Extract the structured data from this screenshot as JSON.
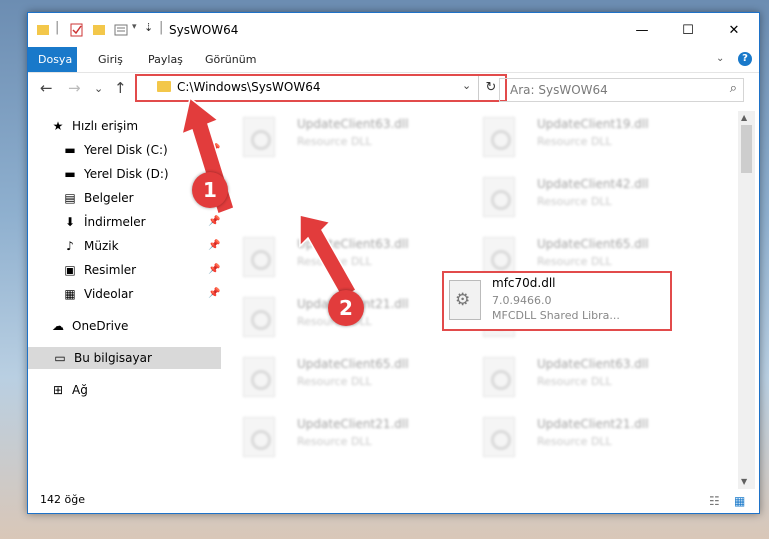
{
  "window": {
    "title": "SysWOW64",
    "minimize": "—",
    "maximize": "☐",
    "close": "✕",
    "help": "?"
  },
  "ribbon": {
    "tabs": [
      "Dosya",
      "Giriş",
      "Paylaş",
      "Görünüm"
    ]
  },
  "address": {
    "path": "C:\\Windows\\SysWOW64",
    "dropdown": "⌄",
    "refresh": "↻"
  },
  "search": {
    "placeholder": "Ara: SysWOW64",
    "icon": "search-icon"
  },
  "nav": {
    "back": "←",
    "forward": "→",
    "recent": "⌄",
    "up": "↑"
  },
  "sidebar": {
    "items": [
      {
        "label": "Hızlı erişim",
        "icon": "star-icon",
        "glyph": "★",
        "pinned": false
      },
      {
        "label": "Yerel Disk (C:)",
        "icon": "drive-icon",
        "glyph": "▬",
        "pinned": true
      },
      {
        "label": "Yerel Disk (D:)",
        "icon": "drive-icon",
        "glyph": "▬",
        "pinned": true
      },
      {
        "label": "Belgeler",
        "icon": "documents-icon",
        "glyph": "▤",
        "pinned": true
      },
      {
        "label": "İndirmeler",
        "icon": "download-icon",
        "glyph": "⬇",
        "pinned": true
      },
      {
        "label": "Müzik",
        "icon": "music-icon",
        "glyph": "♪",
        "pinned": true
      },
      {
        "label": "Resimler",
        "icon": "pictures-icon",
        "glyph": "▣",
        "pinned": true
      },
      {
        "label": "Videolar",
        "icon": "video-icon",
        "glyph": "▦",
        "pinned": true
      },
      {
        "label": "OneDrive",
        "icon": "cloud-icon",
        "glyph": "☁",
        "pinned": false
      },
      {
        "label": "Bu bilgisayar",
        "icon": "computer-icon",
        "glyph": "▭",
        "pinned": false
      },
      {
        "label": "Ağ",
        "icon": "network-icon",
        "glyph": "⊞",
        "pinned": false
      }
    ]
  },
  "files": [
    {
      "name": "UpdateClient63.dll",
      "desc": "Resource DLL"
    },
    {
      "name": "UpdateClient19.dll",
      "desc": "Resource DLL"
    },
    {
      "name": "UpdateClient42.dll",
      "desc": "Resource DLL"
    },
    {
      "name": "UpdateClient63.dll",
      "desc": "Resource DLL"
    },
    {
      "name": "UpdateClient65.dll",
      "desc": "Resource DLL"
    },
    {
      "name": "UpdateClient21.dll",
      "desc": "Resource DLL"
    },
    {
      "name": "UpdateClient42.dll",
      "desc": "Resource DLL"
    },
    {
      "name": "UpdateClient65.dll",
      "desc": "Resource DLL"
    },
    {
      "name": "UpdateClient63.dll",
      "desc": "Resource DLL"
    },
    {
      "name": "UpdateClient21.dll",
      "desc": "Resource DLL"
    },
    {
      "name": "UpdateClient21.dll",
      "desc": "Resource DLL"
    }
  ],
  "highlighted": {
    "name": "mfc70d.dll",
    "version": "7.0.9466.0",
    "desc": "MFCDLL Shared Libra..."
  },
  "status": {
    "count": "142 öğe"
  },
  "annotations": {
    "badge1": "1",
    "badge2": "2"
  },
  "colors": {
    "accent": "#1979ca",
    "highlight": "#e24b4b"
  }
}
